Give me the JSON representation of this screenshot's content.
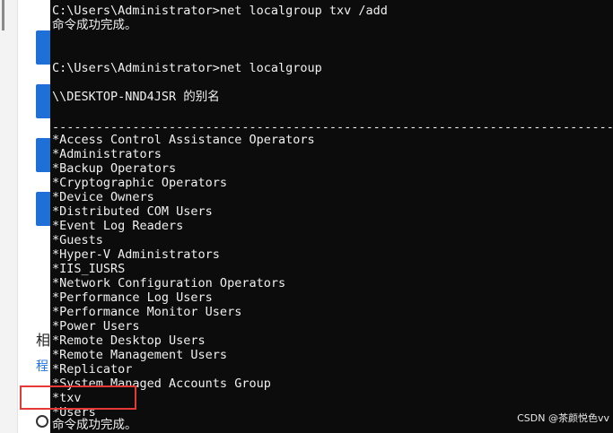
{
  "background": {
    "heading_glyph": "相",
    "link_glyph": "程"
  },
  "console": {
    "cmd1": "C:\\Users\\Administrator>net localgroup txv /add",
    "ok1": "命令成功完成。",
    "cmd2": "C:\\Users\\Administrator>net localgroup",
    "alias_header": "\\\\DESKTOP-NND4JSR 的别名",
    "separator": "-------------------------------------------------------------------------------",
    "groups": [
      "*Access Control Assistance Operators",
      "*Administrators",
      "*Backup Operators",
      "*Cryptographic Operators",
      "*Device Owners",
      "*Distributed COM Users",
      "*Event Log Readers",
      "*Guests",
      "*Hyper-V Administrators",
      "*IIS_IUSRS",
      "*Network Configuration Operators",
      "*Performance Log Users",
      "*Performance Monitor Users",
      "*Power Users",
      "*Remote Desktop Users",
      "*Remote Management Users",
      "*Replicator",
      "*System Managed Accounts Group",
      "*txv",
      "*Users"
    ],
    "ok2": "命令成功完成。"
  },
  "watermark": "CSDN @茶颜悦色vv",
  "colors": {
    "console_bg": "#0c0c0c",
    "console_fg": "#f0f0f0",
    "highlight": "#e53935"
  }
}
